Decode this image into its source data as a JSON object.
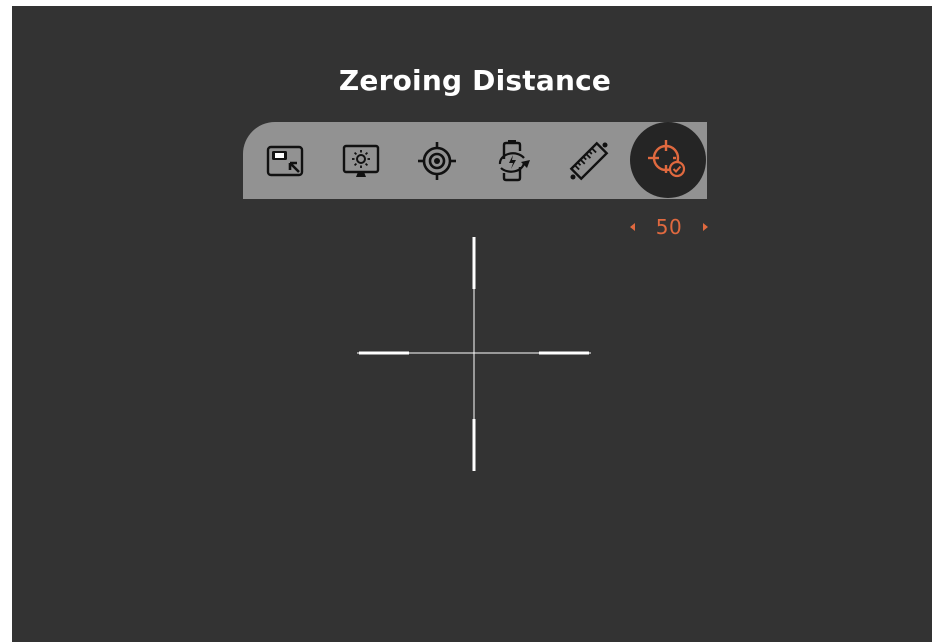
{
  "title": "Zeroing Distance",
  "menu": {
    "items": [
      {
        "name": "picture-in-picture",
        "icon": "pip-icon"
      },
      {
        "name": "display-brightness",
        "icon": "brightness-icon"
      },
      {
        "name": "reticle",
        "icon": "reticle-target-icon"
      },
      {
        "name": "power-saving",
        "icon": "battery-charge-icon"
      },
      {
        "name": "range-finder",
        "icon": "ruler-icon"
      },
      {
        "name": "zeroing-distance",
        "icon": "crosshair-check-icon",
        "active": true
      }
    ]
  },
  "zeroing": {
    "value": "50"
  },
  "colors": {
    "background": "#333333",
    "menu_bar": "#929292",
    "active_circle": "#252525",
    "accent": "#e0693f",
    "icon": "#111111",
    "reticle": "#ffffff"
  }
}
